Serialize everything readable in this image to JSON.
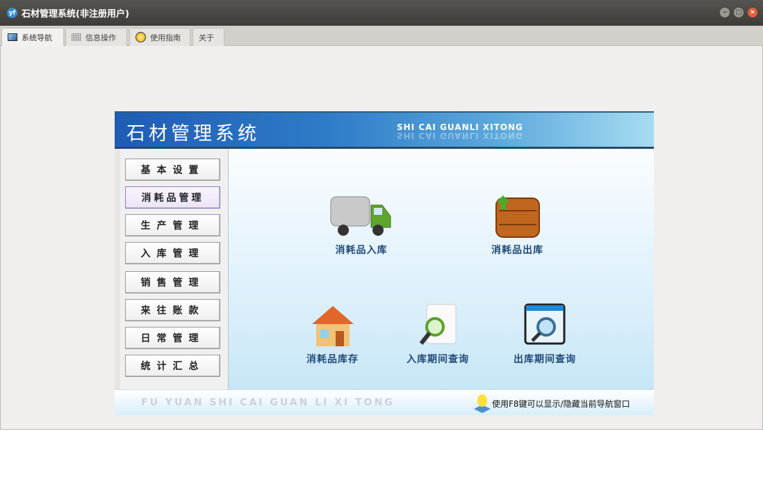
{
  "window": {
    "title": "石材管理系统(非注册用户)"
  },
  "tabs": [
    {
      "label": "系统导航"
    },
    {
      "label": "信息操作"
    },
    {
      "label": "使用指南"
    },
    {
      "label": "关于"
    }
  ],
  "banner": {
    "title": "石材管理系统",
    "subtitle": "SHI CAI GUANLI XITONG"
  },
  "sidebar": {
    "items": [
      {
        "label": "基本设置"
      },
      {
        "label": "消耗品管理"
      },
      {
        "label": "生产管理"
      },
      {
        "label": "入库管理"
      },
      {
        "label": "销售管理"
      },
      {
        "label": "来往账款"
      },
      {
        "label": "日常管理"
      },
      {
        "label": "统计汇总"
      }
    ]
  },
  "functions": [
    {
      "label": "消耗品入库"
    },
    {
      "label": "消耗品出库"
    },
    {
      "label": "消耗品库存"
    },
    {
      "label": "入库期间查询"
    },
    {
      "label": "出库期间查询"
    }
  ],
  "footer": {
    "pinyin": "FU YUAN SHI CAI GUAN LI XI TONG",
    "tip": "使用F8键可以显示/隐藏当前导航窗口"
  }
}
